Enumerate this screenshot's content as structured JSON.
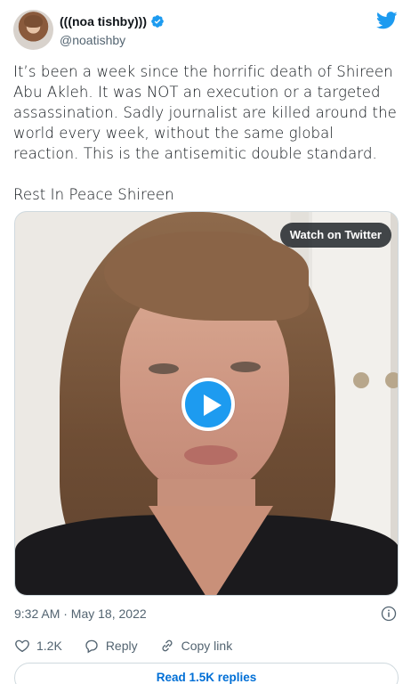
{
  "tweet": {
    "author": {
      "display_name": "(((noa tishby)))",
      "handle": "@noatishby",
      "verified": true
    },
    "paragraphs": [
      "It’s been a week since the horrific death of Shireen Abu Akleh. It was NOT an execution or a targeted assassination. Sadly journalist are killed around the world every week, without the same global reaction. This is the antisemitic double standard.",
      "Rest In Peace Shireen"
    ],
    "media": {
      "watch_label": "Watch on Twitter"
    },
    "timestamp": "9:32 AM · May 18, 2022",
    "actions": {
      "like_count": "1.2K",
      "reply_label": "Reply",
      "copy_label": "Copy link"
    },
    "read_replies_label": "Read 1.5K replies"
  },
  "icons": {
    "brand": "twitter-bird-icon",
    "verified": "verified-badge-icon",
    "play": "play-icon",
    "info": "info-icon",
    "like": "heart-icon",
    "reply": "reply-bubble-icon",
    "copy": "link-icon"
  },
  "colors": {
    "accent": "#1d9bf0",
    "link": "#006fd6",
    "muted_text": "#536471",
    "primary_text": "#0f1419",
    "border": "#cfd9de"
  }
}
